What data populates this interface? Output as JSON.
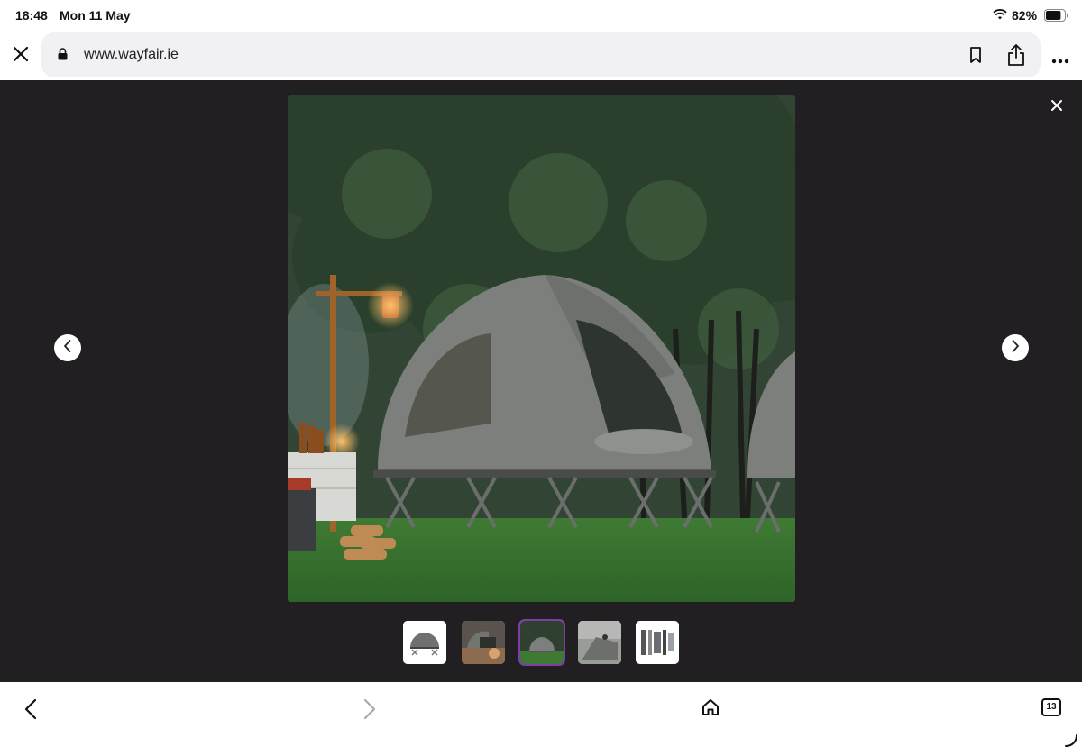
{
  "status": {
    "time": "18:48",
    "date": "Mon 11 May",
    "battery": "82%",
    "battery_level": 0.82
  },
  "browser": {
    "url": "www.wayfair.ie",
    "tab_count": "13"
  },
  "icons": {
    "close": "close-icon",
    "lock": "lock-icon",
    "bookmark": "bookmark-icon",
    "share": "share-icon",
    "more": "more-icon",
    "wifi": "wifi-icon",
    "battery": "battery-icon",
    "prev": "chevron-left-icon",
    "next": "chevron-right-icon",
    "back": "back-icon",
    "forward": "forward-icon",
    "home": "home-icon",
    "tabs": "tabs-icon"
  },
  "gallery": {
    "active_thumbnail": 3,
    "thumbnails": [
      "tent-on-cot-white",
      "tent-interior-view",
      "tent-outdoor-scene",
      "tent-closeup-grey",
      "accessories-parts"
    ]
  },
  "colors": {
    "viewer_bg": "#221f22",
    "active_outline": "#7b3fa7",
    "grass": "#3f7a34",
    "tent": "#7d7f7c"
  }
}
